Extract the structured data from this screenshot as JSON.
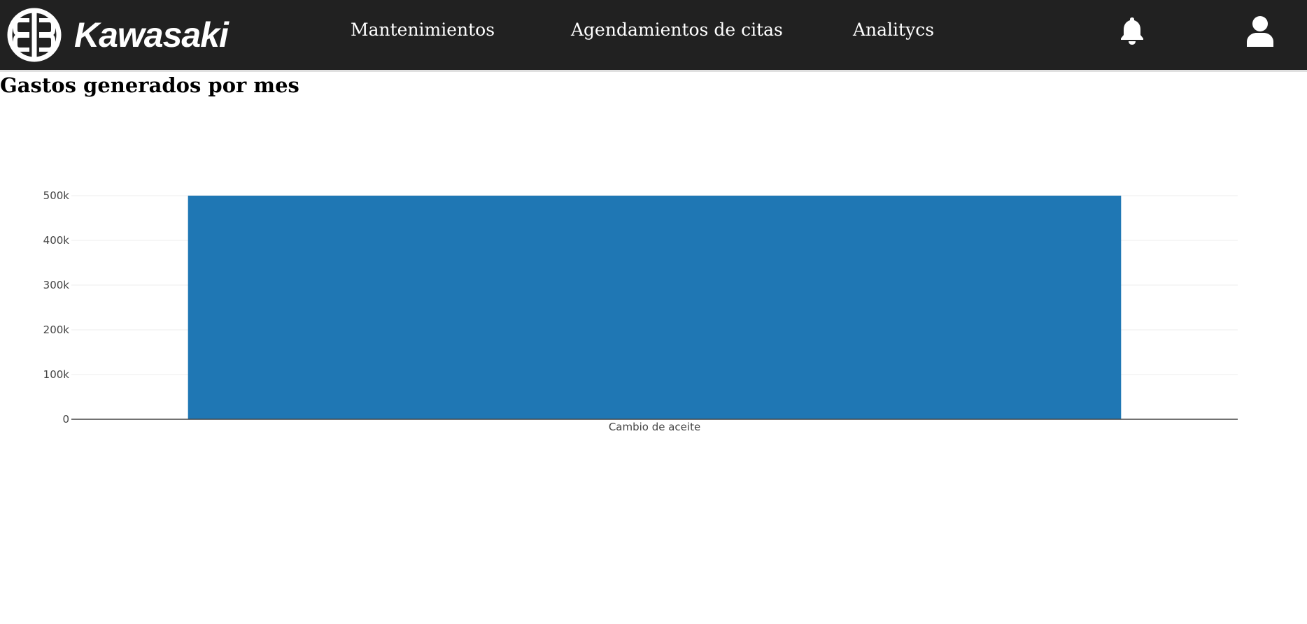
{
  "header": {
    "brand": "Kawasaki",
    "nav": [
      "Mantenimientos",
      "Agendamientos de citas",
      "Analitycs"
    ],
    "icons": {
      "notifications": "bell-icon",
      "account": "user-icon"
    },
    "colors": {
      "background": "#212121",
      "text": "#ffffff"
    }
  },
  "main": {
    "title": "Gastos generados por mes"
  },
  "chart_data": {
    "type": "bar",
    "title": "",
    "xlabel": "",
    "ylabel": "",
    "categories": [
      "Cambio de aceite"
    ],
    "values": [
      500000
    ],
    "ylim": [
      0,
      500000
    ],
    "yticks": [
      0,
      100000,
      200000,
      300000,
      400000,
      500000
    ],
    "ytick_labels": [
      "0",
      "100k",
      "200k",
      "300k",
      "400k",
      "500k"
    ],
    "grid": true,
    "bar_color": "#1f77b4"
  }
}
